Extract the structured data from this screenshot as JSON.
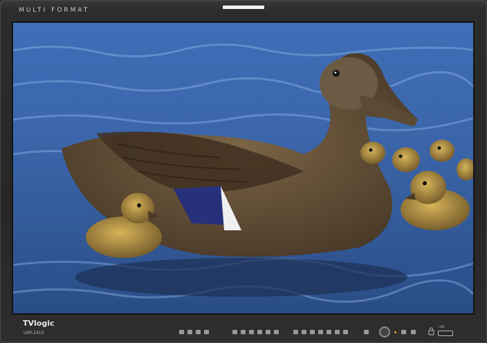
{
  "monitor": {
    "top_label": "MULTI FORMAT",
    "brand": "TVlogic",
    "model": "LVM-241S",
    "usb_label": "USB",
    "tally_color": "#f2f2f2",
    "led_color": "#e0a020"
  },
  "screen": {
    "content": "photo",
    "description_icon": "duck-photo"
  },
  "controls": {
    "button_groups": [
      {
        "group": "left",
        "count": 4
      },
      {
        "group": "middle",
        "count": 6
      },
      {
        "group": "right",
        "count": 7
      },
      {
        "group": "menu",
        "count": 4
      }
    ],
    "icons": [
      "rotary-knob-icon",
      "lock-icon",
      "usb-port-icon"
    ]
  }
}
